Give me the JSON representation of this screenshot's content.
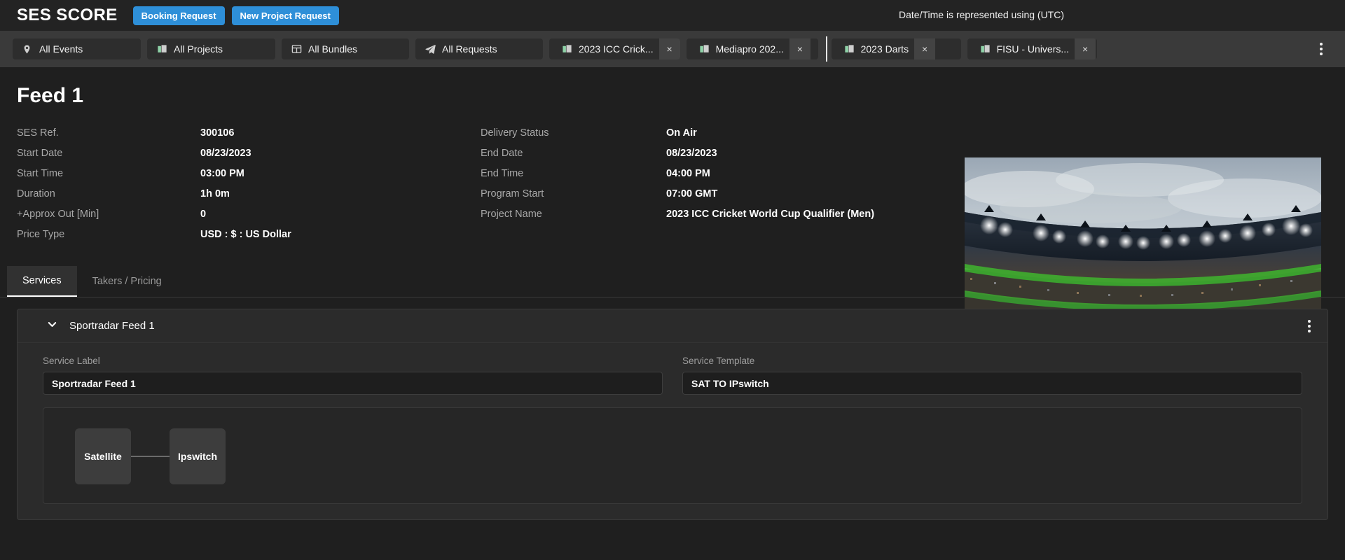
{
  "header": {
    "brand": "SES SCORE",
    "buttons": [
      {
        "label": "Booking Request",
        "name": "booking-request-button"
      },
      {
        "label": "New Project Request",
        "name": "new-project-request-button"
      }
    ],
    "timezone_note": "Date/Time is represented using (UTC)",
    "accent_color": "#2e8fd8"
  },
  "navtabs": {
    "items": [
      {
        "label": "All Events",
        "icon": "location-pin-icon",
        "closable": false
      },
      {
        "label": "All Projects",
        "icon": "building-icon",
        "closable": false
      },
      {
        "label": "All Bundles",
        "icon": "bundle-icon",
        "closable": false
      },
      {
        "label": "All Requests",
        "icon": "paper-plane-icon",
        "closable": false
      },
      {
        "label": "2023 ICC Crick...",
        "icon": "building-icon",
        "closable": true,
        "close_label": "×"
      },
      {
        "label": "Mediapro 202...",
        "icon": "building-icon",
        "closable": true,
        "close_label": "×"
      },
      {
        "label": "2023 Darts",
        "icon": "building-icon",
        "closable": true,
        "close_label": "×"
      },
      {
        "label": "FISU - Univers...",
        "icon": "building-icon",
        "closable": true,
        "close_label": "×"
      }
    ],
    "overflow_icon": "kebab-menu-icon"
  },
  "detail": {
    "title": "Feed 1",
    "left_fields": [
      {
        "label": "SES Ref.",
        "value": "300106"
      },
      {
        "label": "Start Date",
        "value": "08/23/2023"
      },
      {
        "label": "Start Time",
        "value": "03:00 PM"
      },
      {
        "label": "Duration",
        "value": "1h 0m"
      },
      {
        "label": "+Approx Out [Min]",
        "value": "0"
      },
      {
        "label": "Price Type",
        "value": "USD : $ : US Dollar"
      }
    ],
    "right_fields": [
      {
        "label": "Delivery Status",
        "value": "On Air"
      },
      {
        "label": "End Date",
        "value": "08/23/2023"
      },
      {
        "label": "End Time",
        "value": "04:00 PM"
      },
      {
        "label": "Program Start",
        "value": "07:00 GMT"
      },
      {
        "label": "Project Name",
        "value": "2023 ICC Cricket World Cup Qualifier (Men)"
      }
    ],
    "thumbnail_name": "stadium-thumbnail"
  },
  "section_tabs": [
    {
      "label": "Services",
      "active": true
    },
    {
      "label": "Takers / Pricing",
      "active": false
    }
  ],
  "service": {
    "title": "Sportradar Feed 1",
    "expanded": true,
    "collapse_icon": "chevron-down-icon",
    "menu_icon": "kebab-menu-icon",
    "fields": [
      {
        "label": "Service Label",
        "value": "Sportradar Feed 1"
      },
      {
        "label": "Service Template",
        "value": "SAT TO IPswitch"
      }
    ],
    "diagram": {
      "nodes": [
        {
          "label": "Satellite"
        },
        {
          "label": "Ipswitch"
        }
      ]
    }
  }
}
